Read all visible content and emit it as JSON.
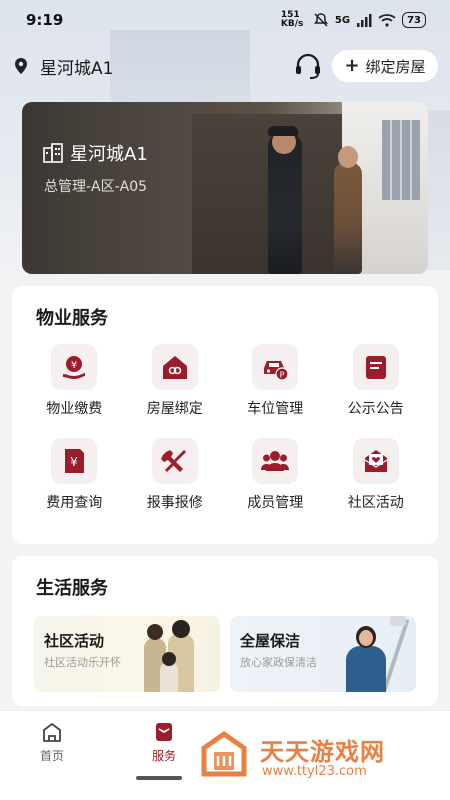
{
  "status_bar": {
    "time": "9:19",
    "net_speed": "151 KB/s",
    "network": "5G",
    "battery": "73"
  },
  "header": {
    "location": "星河城A1",
    "bind_button": "绑定房屋"
  },
  "banner": {
    "title": "星河城A1",
    "subtitle": "总管理-A区-A05"
  },
  "property_service": {
    "title": "物业服务",
    "items": [
      {
        "label": "物业缴费",
        "icon": "payment-icon"
      },
      {
        "label": "房屋绑定",
        "icon": "house-link-icon"
      },
      {
        "label": "车位管理",
        "icon": "car-parking-icon"
      },
      {
        "label": "公示公告",
        "icon": "notice-icon"
      },
      {
        "label": "费用查询",
        "icon": "fee-query-icon"
      },
      {
        "label": "报事报修",
        "icon": "repair-tools-icon"
      },
      {
        "label": "成员管理",
        "icon": "members-icon"
      },
      {
        "label": "社区活动",
        "icon": "community-event-icon"
      }
    ]
  },
  "life_service": {
    "title": "生活服务",
    "tiles": [
      {
        "title": "社区活动",
        "subtitle": "社区活动乐开怀"
      },
      {
        "title": "全屋保洁",
        "subtitle": "放心家政保清洁"
      }
    ]
  },
  "bottom_nav": {
    "items": [
      {
        "label": "首页",
        "icon": "home-icon"
      },
      {
        "label": "服务",
        "icon": "service-icon",
        "active": true
      }
    ]
  },
  "watermark": {
    "title": "天天游戏网",
    "url": "www.ttyl23.com"
  },
  "colors": {
    "accent": "#9b1c2b",
    "icon_bg": "#f6efef"
  }
}
